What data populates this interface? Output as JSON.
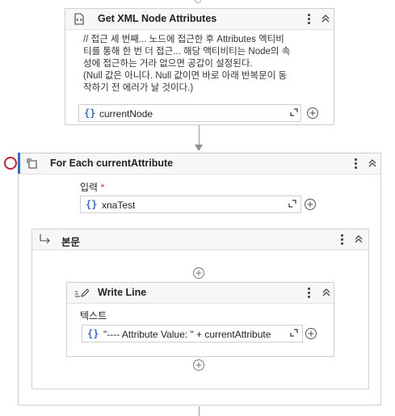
{
  "get_xml": {
    "title": "Get XML Node Attributes",
    "comment_lines": [
      "// 접근 세 번째... 노드에 접근한 후 Attributes 엑티비",
      "티를 통해 한 번 더 접근... 해당 액티비티는 Node의 속",
      "성에 접근하는 거라 없으면 공갑이 설정된다.",
      "(Null 값은 아니다. Null 값이면 바로 아래 반복문이 동",
      "작하기 전 에러가 날 것이다.)"
    ],
    "field_value": "currentNode",
    "brace": "{}"
  },
  "for_each": {
    "title": "For Each currentAttribute",
    "input_label": "입력",
    "required_mark": "*",
    "input_value": "xnaTest",
    "brace": "{}"
  },
  "body": {
    "title": "본문"
  },
  "write_line": {
    "title": "Write Line",
    "text_label": "텍스트",
    "text_value": "\"---- Attribute Value: \" + currentAttribute",
    "brace": "{}"
  },
  "icons": [
    "xml-icon",
    "loop-icon",
    "body-arrow-icon",
    "pen-icon",
    "kebab-icon",
    "collapse-chevron-icon",
    "expand-icon",
    "add-circle-icon",
    "breakpoint-icon"
  ],
  "colors": {
    "accent": "#2f6fd6",
    "breakpoint": "#c8202f",
    "border": "#cfcfcf",
    "header_bg": "#f7f7f7"
  }
}
